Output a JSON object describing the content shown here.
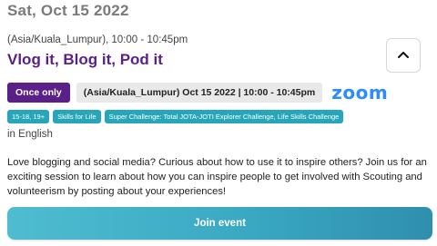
{
  "event": {
    "date": "Sat, Oct 15 2022",
    "time_line": "(Asia/Kuala_Lumpur), 10:00 - 10:45pm",
    "title": "Vlog it, Blog it, Pod it",
    "frequency_badge": "Once only",
    "datetime_chip": "(Asia/Kuala_Lumpur) Oct 15 2022 | 10:00 - 10:45pm",
    "platform_logo": "zoom",
    "tags": [
      "15-18, 19+",
      "Skills for Life",
      "Super Challenge: Total JOTA-JOTI Explorer Challenge, Life Skills Challenge"
    ],
    "language": "in English",
    "description": "Love blogging and social media? Curious about how to use it to inspire others? Join us for an exciting session to learn about how you can inspire people to get involved with Scouting and volunteerism by posting about your experiences!",
    "join_label": "Join event"
  },
  "icons": {
    "collapse": "chevron-up-icon"
  },
  "colors": {
    "title": "#5b1f8a",
    "badge": "#5b1f8a",
    "tag": "#26a6b8",
    "zoom": "#2d8cff",
    "join_button": "#3aa9c2"
  }
}
